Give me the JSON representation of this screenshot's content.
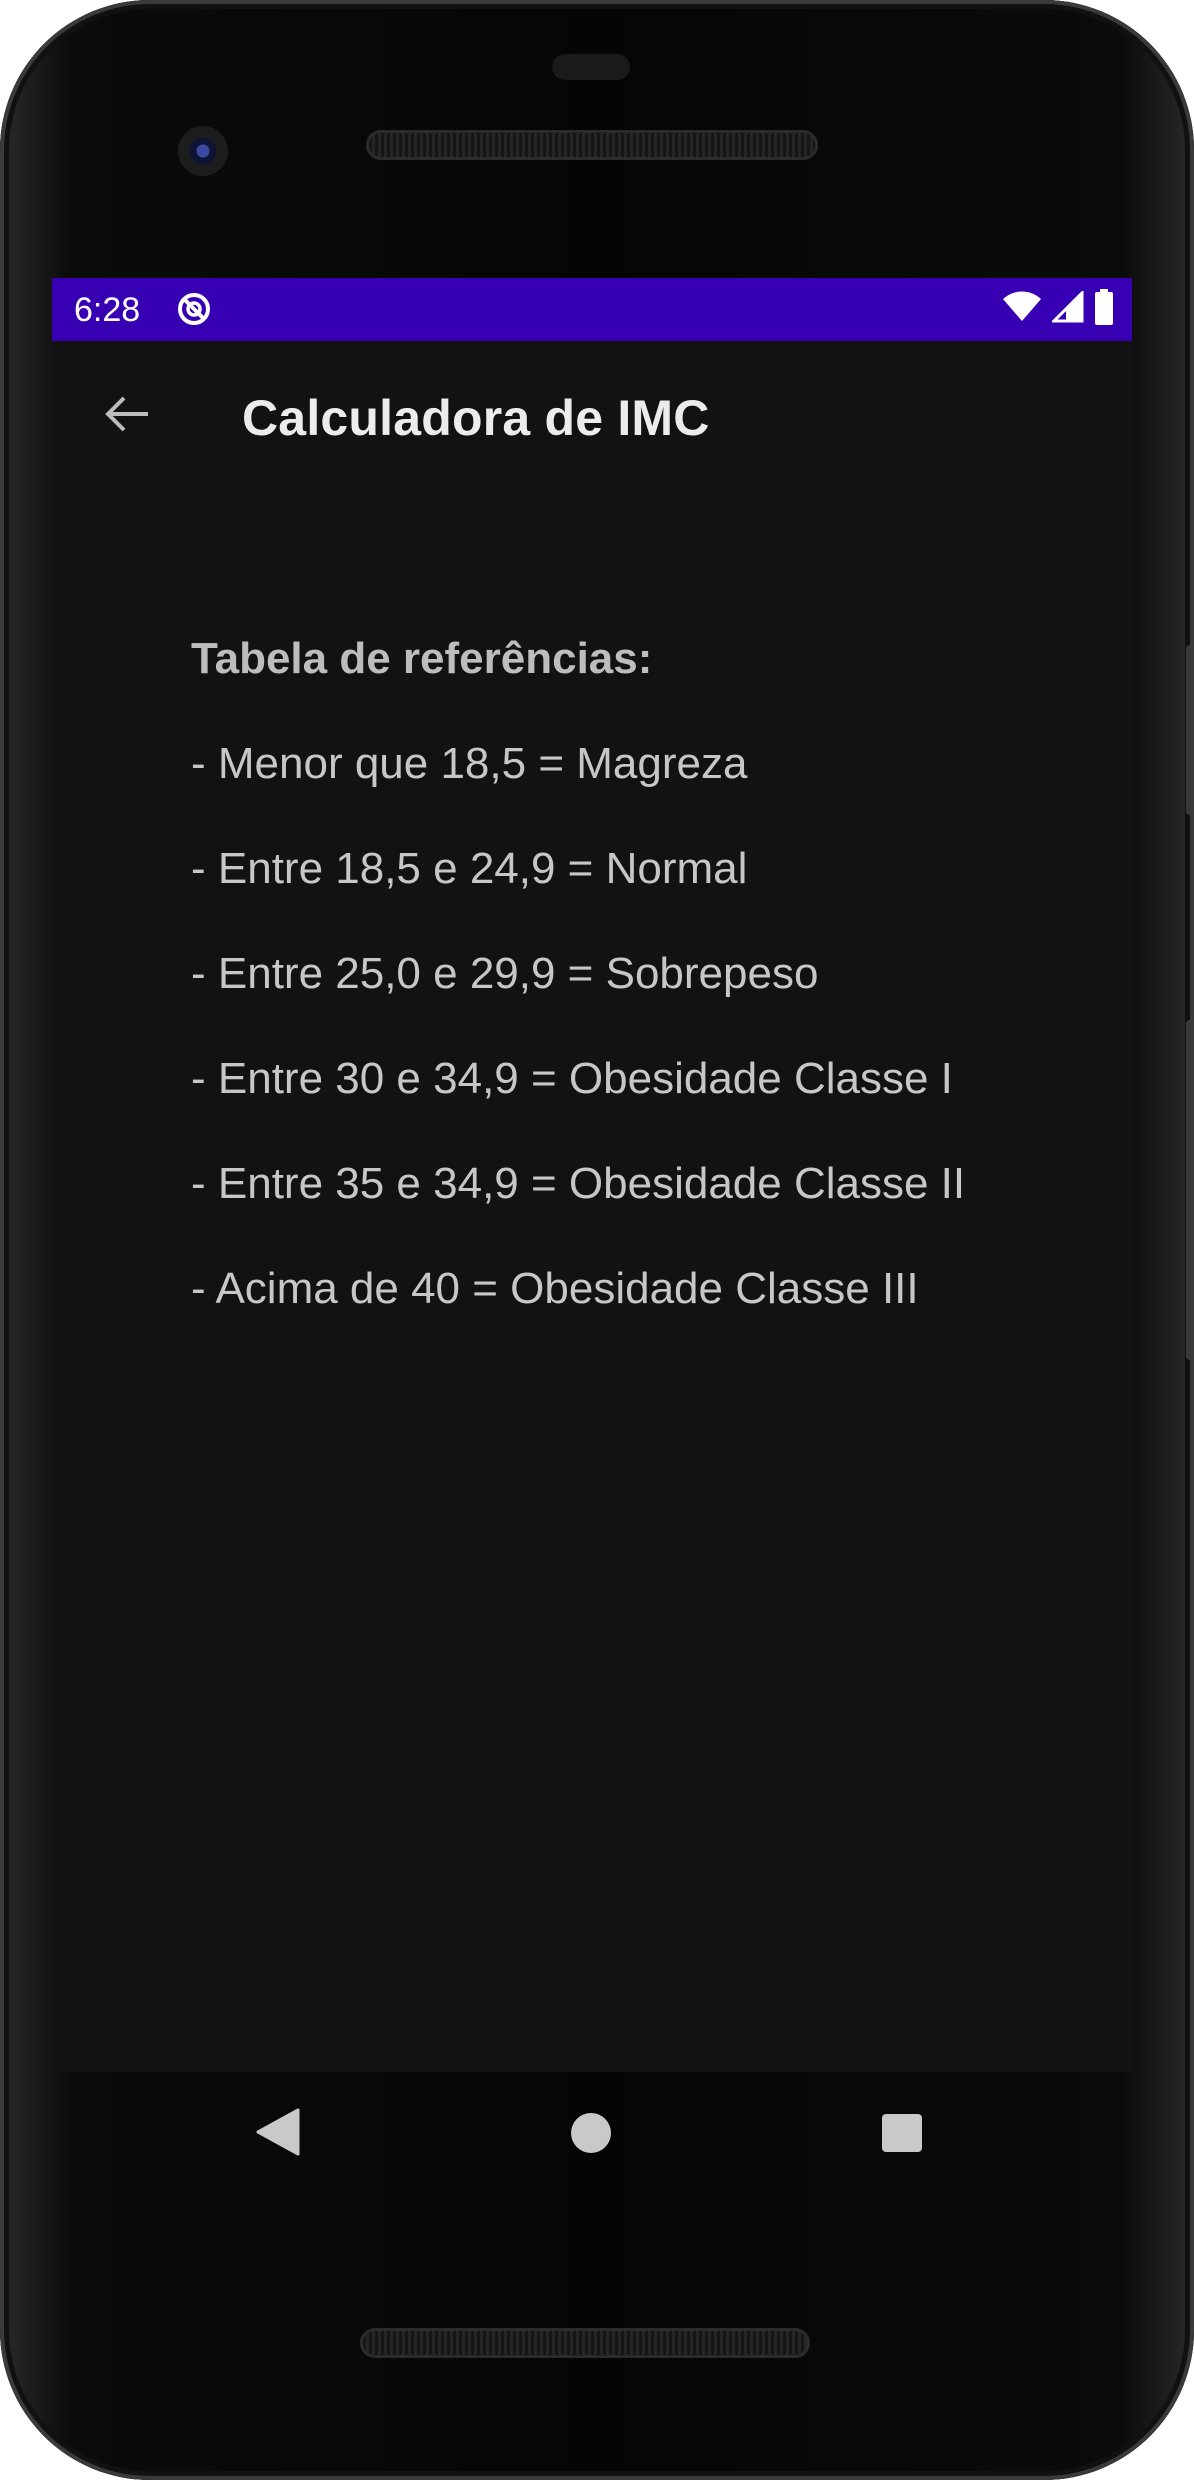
{
  "status_bar": {
    "time": "6:28",
    "background_color": "#3700b3",
    "icons": [
      "data-saver-icon",
      "wifi-icon",
      "cellular-signal-icon",
      "battery-icon"
    ]
  },
  "app_bar": {
    "title": "Calculadora de IMC",
    "back_icon": "arrow-back-icon"
  },
  "reference_table": {
    "heading": "Tabela de referências:",
    "items": [
      "- Menor que 18,5 = Magreza",
      "- Entre 18,5 e 24,9 = Normal",
      "- Entre 25,0 e 29,9 = Sobrepeso",
      "- Entre 30 e 34,9 = Obesidade Classe I",
      "- Entre 35 e 34,9 = Obesidade Classe II",
      "- Acima de 40 = Obesidade Classe III"
    ]
  },
  "navigation_bar": {
    "icons": [
      "nav-back-icon",
      "nav-home-icon",
      "nav-recents-icon"
    ]
  },
  "colors": {
    "screen_background": "#121212",
    "status_bar": "#3700b3",
    "title_text": "#ececec",
    "body_text": "#c7c7c7"
  }
}
